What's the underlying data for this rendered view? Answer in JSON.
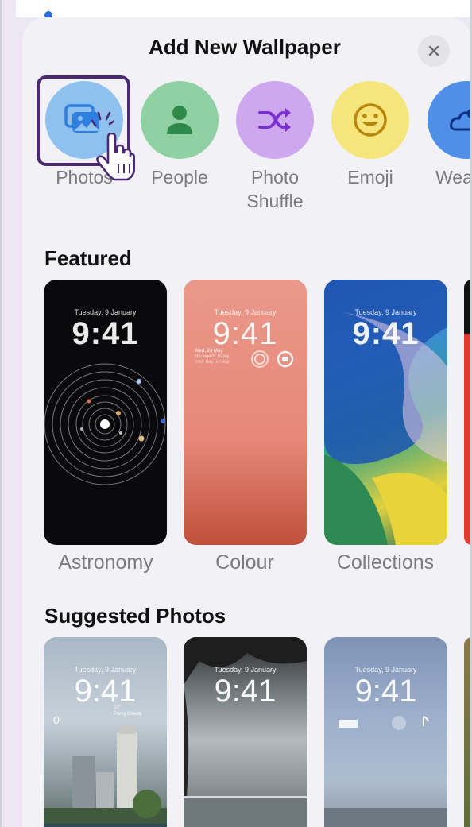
{
  "sheet": {
    "title": "Add New Wallpaper"
  },
  "types": [
    {
      "label": "Photos",
      "icon": "photos-icon",
      "color": "#8fc1ef"
    },
    {
      "label": "People",
      "icon": "person-icon",
      "color": "#8fd1a2"
    },
    {
      "label": "Photo\nShuffle",
      "icon": "shuffle-icon",
      "color": "#cda8ef"
    },
    {
      "label": "Emoji",
      "icon": "smiley-icon",
      "color": "#f6e57a"
    },
    {
      "label": "Weat",
      "icon": "weather-icon",
      "color": "#4f8fe8"
    }
  ],
  "featured": {
    "title": "Featured",
    "cards": [
      {
        "label": "Astronomy",
        "date": "Tuesday, 9 January",
        "time": "9:41"
      },
      {
        "label": "Colour",
        "date": "Tuesday, 9 January",
        "time": "9:41",
        "widget_date": "Wed, 24 May",
        "widget_line1": "No events today",
        "widget_line2": "Your day is clear"
      },
      {
        "label": "Collections",
        "date": "Tuesday, 9 January",
        "time": "9:41"
      }
    ]
  },
  "suggested": {
    "title": "Suggested Photos",
    "cards": [
      {
        "date": "Tuesday, 9 January",
        "time": "9:41",
        "weather_temp": "22°",
        "weather_text": "Partly Cloudy",
        "widget_value": "0"
      },
      {
        "date": "Tuesday, 9 January",
        "time": "9:41"
      },
      {
        "date": "Tuesday, 9 January",
        "time": "9:41"
      }
    ]
  },
  "colors": {
    "sheet_bg": "#f2f2f6",
    "selection_border": "#4c2a72",
    "page_bg": "#ece7f3"
  }
}
